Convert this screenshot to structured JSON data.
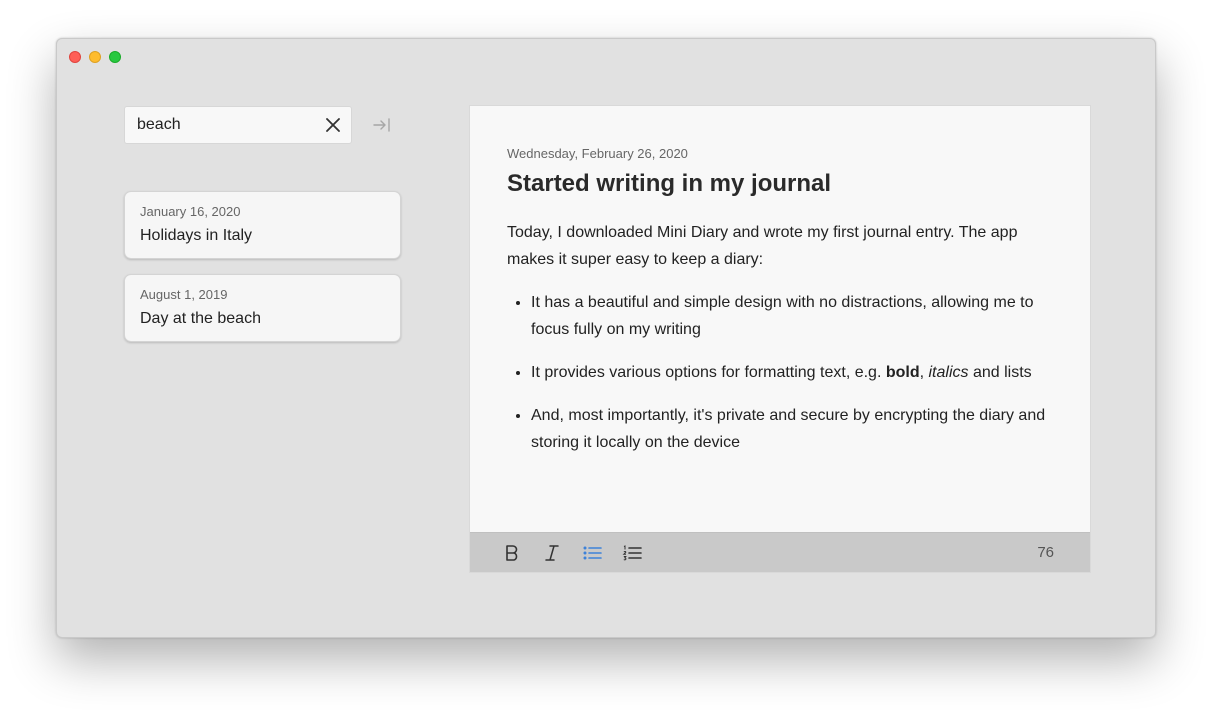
{
  "window": {
    "traffic_lights": [
      "close",
      "minimize",
      "maximize"
    ]
  },
  "search": {
    "value": "beach",
    "clear_icon": "close-x-icon",
    "jump_icon": "arrow-to-right-icon"
  },
  "entries": [
    {
      "date": "January 16, 2020",
      "title": "Holidays in Italy"
    },
    {
      "date": "August 1, 2019",
      "title": "Day at the beach"
    }
  ],
  "editor": {
    "date": "Wednesday, February 26, 2020",
    "title": "Started writing in my journal",
    "intro": "Today, I downloaded Mini Diary and wrote my first journal entry. The app makes it super easy to keep a diary:",
    "bullets": {
      "item1": "It has a beautiful and simple design with no distractions, allowing me to focus fully on my writing",
      "item2_pre": "It provides various options for formatting text, e.g. ",
      "item2_bold": "bold",
      "item2_comma": ", ",
      "item2_italic": "italics",
      "item2_post": " and lists",
      "item3": "And, most importantly, it's private and secure by encrypting the diary and storing it locally on the device"
    }
  },
  "toolbar": {
    "tools": [
      "bold-icon",
      "italic-icon",
      "bullet-list-icon",
      "numbered-list-icon"
    ],
    "active_tool": "bullet-list-icon",
    "active_color": "#3d82d9",
    "word_count": "76"
  }
}
